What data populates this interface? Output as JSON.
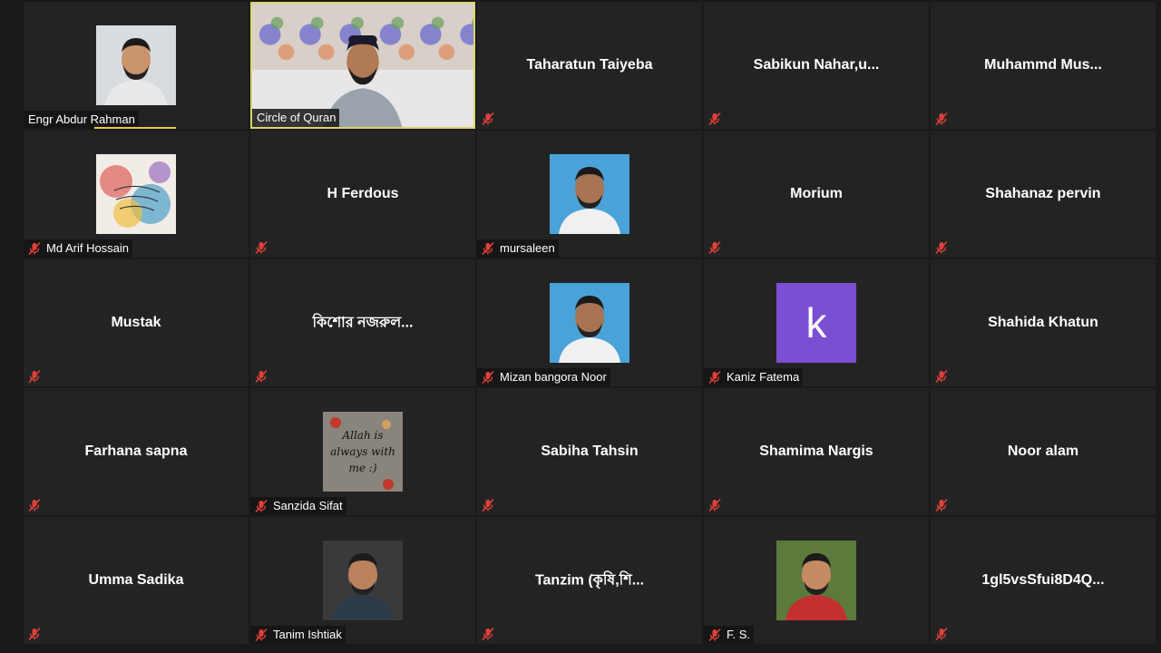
{
  "meeting": {
    "participants": [
      {
        "name": "Engr Abdur Rahman",
        "display": "photo",
        "photo_icon": "person-photo",
        "muted": false,
        "speaking": true
      },
      {
        "name": "Circle of Quran",
        "display": "video",
        "photo_icon": "live-video",
        "muted": false,
        "active_speaker": true
      },
      {
        "name": "Taharatun Taiyeba",
        "display": "name",
        "muted": true
      },
      {
        "name": "Sabikun  Nahar,u...",
        "display": "name",
        "muted": true
      },
      {
        "name": "Muhammd  Mus...",
        "display": "name",
        "muted": true
      },
      {
        "name": "Md Arif Hossain",
        "display": "photo",
        "photo_icon": "artwork-photo",
        "muted": true
      },
      {
        "name": "H Ferdous",
        "display": "name",
        "muted": true
      },
      {
        "name": "mursaleen",
        "display": "photo",
        "photo_icon": "person-photo",
        "muted": true
      },
      {
        "name": "Morium",
        "display": "name",
        "muted": true
      },
      {
        "name": "Shahanaz pervin",
        "display": "name",
        "muted": true
      },
      {
        "name": "Mustak",
        "display": "name",
        "muted": true
      },
      {
        "name": "কিশোর নজরুল...",
        "display": "name",
        "muted": true
      },
      {
        "name": "Mizan  bangora Noor",
        "display": "photo",
        "photo_icon": "person-photo",
        "muted": true
      },
      {
        "name": "Kaniz Fatema",
        "display": "letter",
        "letter": "k",
        "letter_color": "#7c4ed1",
        "muted": true
      },
      {
        "name": "Shahida Khatun",
        "display": "name",
        "muted": true
      },
      {
        "name": "Farhana sapna",
        "display": "name",
        "muted": true
      },
      {
        "name": "Sanzida Sifat",
        "display": "photo",
        "photo_icon": "quote-photo",
        "photo_text": [
          "Allah is",
          "always with",
          "me :)"
        ],
        "muted": true
      },
      {
        "name": "Sabiha Tahsin",
        "display": "name",
        "muted": true
      },
      {
        "name": "Shamima Nargis",
        "display": "name",
        "muted": true
      },
      {
        "name": "Noor alam",
        "display": "name",
        "muted": true
      },
      {
        "name": "Umma Sadika",
        "display": "name",
        "muted": true
      },
      {
        "name": "Tanim Ishtiak",
        "display": "photo",
        "photo_icon": "person-photo",
        "muted": true
      },
      {
        "name": "Tanzim  (কৃষি,শি...",
        "display": "name",
        "muted": true
      },
      {
        "name": "F. S.",
        "display": "photo",
        "photo_icon": "person-photo",
        "muted": true
      },
      {
        "name": "1gl5vsSfui8D4Q...",
        "display": "name",
        "muted": true
      }
    ]
  },
  "icons": {
    "muted": "mic-muted-icon"
  },
  "colors": {
    "background": "#1a1a1a",
    "tile": "#232323",
    "active_border": "#d9d56a",
    "muted_icon": "#e0403a"
  }
}
